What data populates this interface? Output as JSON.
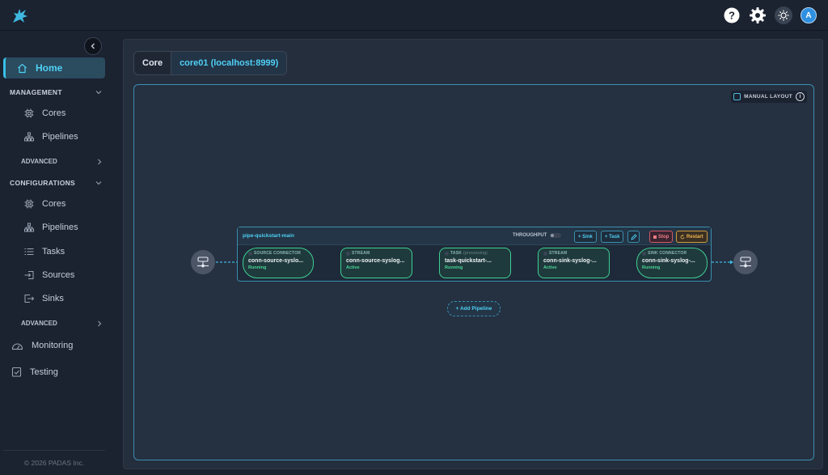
{
  "topbar": {
    "icons": [
      "help-icon",
      "gear-icon",
      "sun-icon"
    ],
    "avatar_initial": "A"
  },
  "sidebar": {
    "home_label": "Home",
    "management": {
      "title": "MANAGEMENT",
      "items": [
        {
          "label": "Cores",
          "icon": "chip-icon"
        },
        {
          "label": "Pipelines",
          "icon": "hierarchy-icon"
        }
      ],
      "advanced": "ADVANCED"
    },
    "configurations": {
      "title": "CONFIGURATIONS",
      "items": [
        {
          "label": "Cores",
          "icon": "chip-icon"
        },
        {
          "label": "Pipelines",
          "icon": "hierarchy-icon"
        },
        {
          "label": "Tasks",
          "icon": "list-icon"
        },
        {
          "label": "Sources",
          "icon": "source-icon"
        },
        {
          "label": "Sinks",
          "icon": "sink-icon"
        }
      ],
      "advanced": "ADVANCED"
    },
    "monitoring_label": "Monitoring",
    "testing_label": "Testing",
    "footer": "© 2026 PADAS Inc."
  },
  "main": {
    "core_key": "Core",
    "core_value": "core01 (localhost:8999)",
    "manual_layout": "MANUAL LAYOUT",
    "info_glyph": "i",
    "pipeline": {
      "name": "pipe-quickstart-main",
      "throughput": "THROUGHPUT",
      "sink_btn": "+ Sink",
      "task_btn": "+ Task",
      "stop_btn": "Stop",
      "restart_btn": "Restart",
      "nodes": [
        {
          "type": "SOURCE CONNECTOR",
          "name": "conn-source-syslo...",
          "status": "Running"
        },
        {
          "type": "STREAM",
          "name": "conn-source-syslog...",
          "status": "Active"
        },
        {
          "type": "TASK",
          "subtype": "(processing)",
          "name": "task-quickstart-...",
          "status": "Running"
        },
        {
          "type": "STREAM",
          "name": "conn-sink-syslog-...",
          "status": "Active"
        },
        {
          "type": "SINK CONNECTOR",
          "name": "conn-sink-syslog-...",
          "status": "Running"
        }
      ]
    },
    "add_pipeline": "+ Add Pipeline"
  },
  "colors": {
    "accent": "#4fd0f5",
    "node_border": "#3fcf93",
    "status_green": "#48d49a",
    "stop_red": "#f07b86",
    "restart_orange": "#f0b44b"
  }
}
